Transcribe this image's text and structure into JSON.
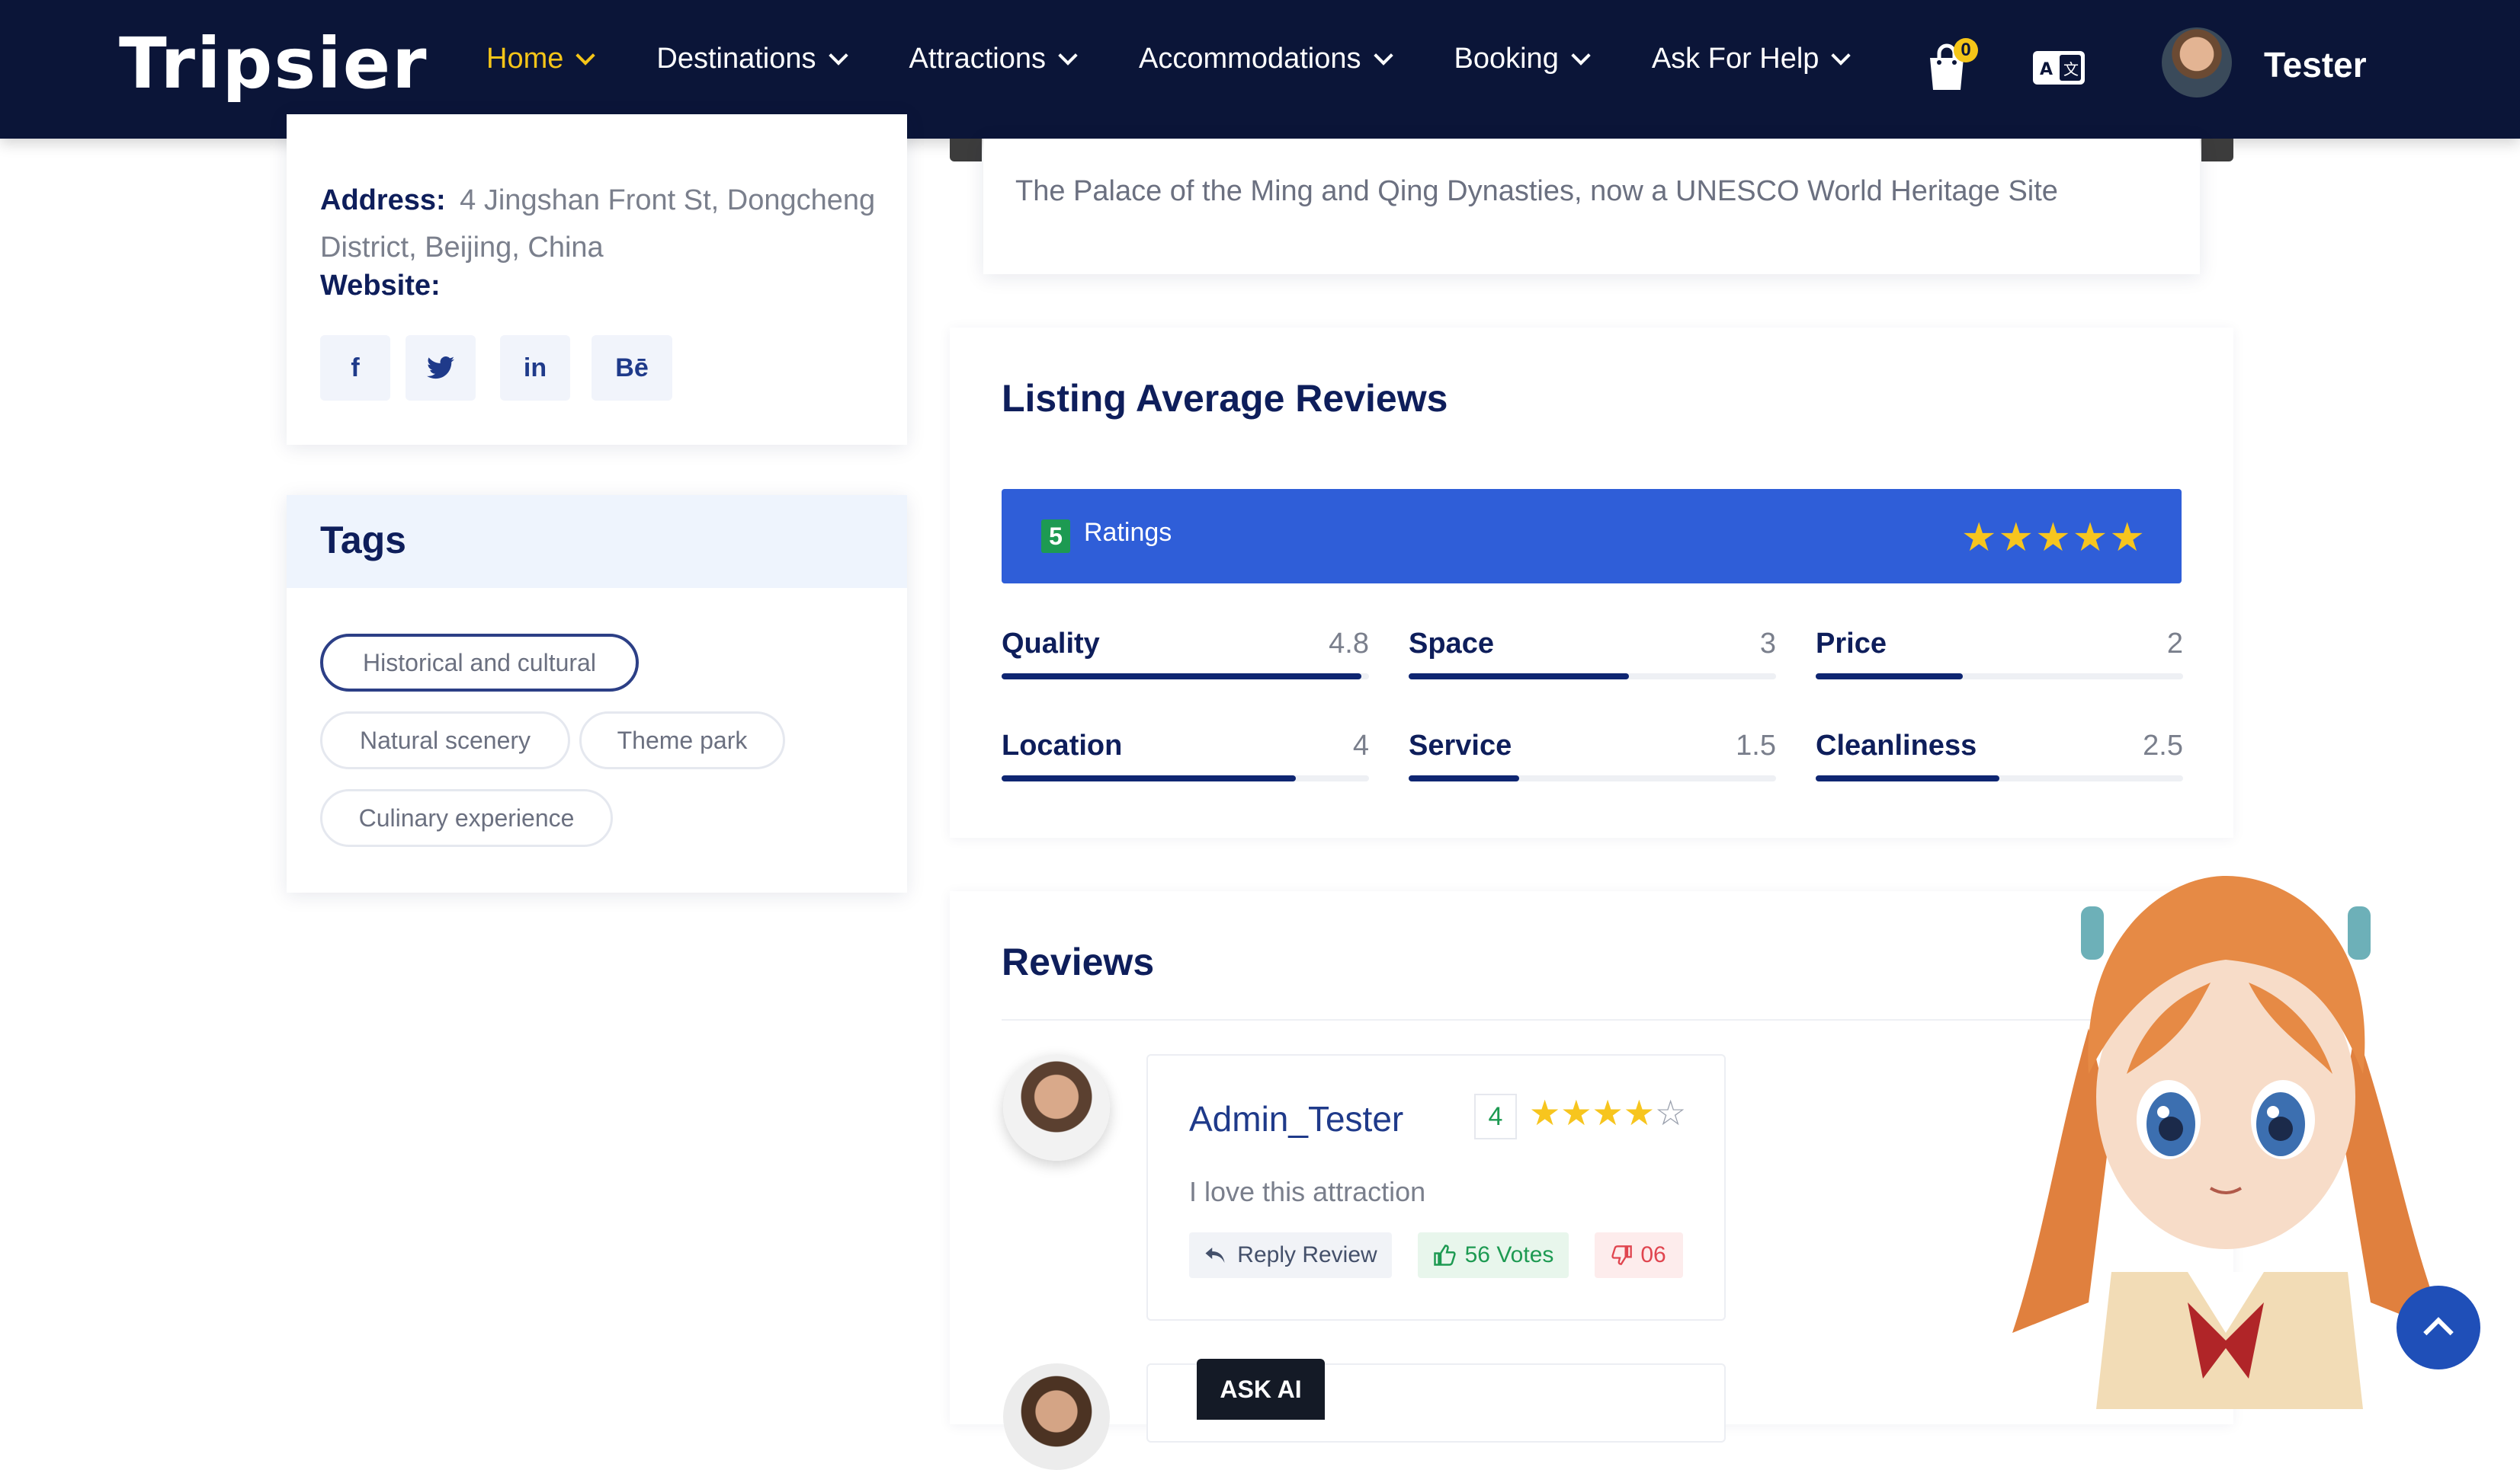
{
  "header": {
    "logo": "Tripsier",
    "nav": [
      {
        "label": "Home",
        "active": true
      },
      {
        "label": "Destinations"
      },
      {
        "label": "Attractions"
      },
      {
        "label": "Accommodations"
      },
      {
        "label": "Booking"
      },
      {
        "label": "Ask For Help"
      }
    ],
    "cart_count": "0",
    "user": "Tester"
  },
  "info": {
    "address_label": "Address:",
    "address_line1": "4 Jingshan Front St, Dongcheng",
    "address_line2": "District, Beijing, China",
    "website_label": "Website:",
    "social": [
      "f",
      "t",
      "in",
      "Bē"
    ]
  },
  "tags": {
    "title": "Tags",
    "items": [
      "Historical and cultural",
      "Natural scenery",
      "Theme park",
      "Culinary experience"
    ]
  },
  "description": "The Palace of the Ming and Qing Dynasties, now a UNESCO World Heritage Site",
  "average": {
    "title": "Listing Average Reviews",
    "rating_count": "5",
    "rating_label": "Ratings",
    "stars": "★★★★★",
    "metrics": [
      {
        "name": "Quality",
        "value": "4.8",
        "fraction": 0.98
      },
      {
        "name": "Space",
        "value": "3",
        "fraction": 0.6
      },
      {
        "name": "Price",
        "value": "2",
        "fraction": 0.4
      },
      {
        "name": "Location",
        "value": "4",
        "fraction": 0.8
      },
      {
        "name": "Service",
        "value": "1.5",
        "fraction": 0.3
      },
      {
        "name": "Cleanliness",
        "value": "2.5",
        "fraction": 0.5
      }
    ]
  },
  "reviews": {
    "title": "Reviews",
    "items": [
      {
        "name": "Admin_Tester",
        "score": "4",
        "stars_full": "★★★★",
        "stars_empty": "☆",
        "text": "I love this attraction",
        "reply_label": "Reply Review",
        "votes_label": "56 Votes",
        "down_label": "06"
      }
    ]
  },
  "ask_ai": "ASK AI",
  "colors": {
    "header_bg": "#0b1538",
    "active_nav": "#f5c518",
    "ratings_bar": "#2f5ed8",
    "metric_fill": "#0f2672",
    "star": "#f7c51e"
  }
}
